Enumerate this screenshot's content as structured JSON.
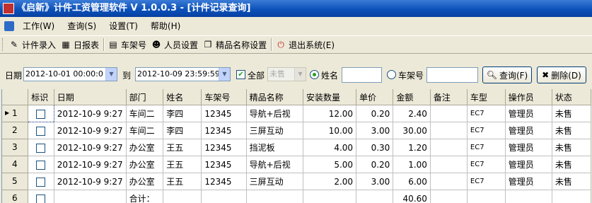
{
  "window": {
    "title": "《启新》计件工资管理软件 V 1.0.0.3 - [计件记录查询]"
  },
  "menu": [
    "工作(W)",
    "查询(S)",
    "设置(T)",
    "帮助(H)"
  ],
  "toolbar": {
    "buttons": [
      {
        "icon": "edit-icon",
        "label": "计件录入"
      },
      {
        "icon": "calendar-icon",
        "label": "日报表"
      },
      {
        "icon": "rack-icon",
        "label": "车架号"
      },
      {
        "icon": "people-icon",
        "label": "人员设置"
      },
      {
        "icon": "tag-icon",
        "label": "精品名称设置"
      },
      {
        "icon": "exit-icon",
        "label": "退出系统(E)"
      }
    ]
  },
  "filter": {
    "date_label": "日期",
    "date_from": "2012-10-01 00:00:0",
    "to_label": "到",
    "date_to": "2012-10-09 23:59:59",
    "all_label": "全部",
    "status_value": "未售",
    "name_label": "姓名",
    "rack_label": "车架号",
    "query_button": "查询(F)",
    "delete_button": "删除(D)"
  },
  "table": {
    "columns": [
      "标识",
      "日期",
      "部门",
      "姓名",
      "车架号",
      "精品名称",
      "安装数量",
      "单价",
      "金额",
      "备注",
      "车型",
      "操作员",
      "状态"
    ],
    "rows": [
      {
        "rn": "1",
        "date": "2012-10-9 9:27",
        "dept": "车间二",
        "name": "李四",
        "rack": "12345",
        "item": "导航+后视",
        "qty": "12.00",
        "price": "0.20",
        "amount": "2.40",
        "note": "",
        "model": "EC7",
        "operator": "管理员",
        "status": "未售"
      },
      {
        "rn": "2",
        "date": "2012-10-9 9:27",
        "dept": "车间二",
        "name": "李四",
        "rack": "12345",
        "item": "三屏互动",
        "qty": "10.00",
        "price": "3.00",
        "amount": "30.00",
        "note": "",
        "model": "EC7",
        "operator": "管理员",
        "status": "未售"
      },
      {
        "rn": "3",
        "date": "2012-10-9 9:27",
        "dept": "办公室",
        "name": "王五",
        "rack": "12345",
        "item": "挡泥板",
        "qty": "4.00",
        "price": "0.30",
        "amount": "1.20",
        "note": "",
        "model": "EC7",
        "operator": "管理员",
        "status": "未售"
      },
      {
        "rn": "4",
        "date": "2012-10-9 9:27",
        "dept": "办公室",
        "name": "王五",
        "rack": "12345",
        "item": "导航+后视",
        "qty": "5.00",
        "price": "0.20",
        "amount": "1.00",
        "note": "",
        "model": "EC7",
        "operator": "管理员",
        "status": "未售"
      },
      {
        "rn": "5",
        "date": "2012-10-9 9:27",
        "dept": "办公室",
        "name": "王五",
        "rack": "12345",
        "item": "三屏互动",
        "qty": "2.00",
        "price": "3.00",
        "amount": "6.00",
        "note": "",
        "model": "EC7",
        "operator": "管理员",
        "status": "未售"
      },
      {
        "rn": "6",
        "date": "",
        "dept": "合计：",
        "name": "",
        "rack": "",
        "item": "",
        "qty": "",
        "price": "",
        "amount": "40.60",
        "note": "",
        "model": "",
        "operator": "",
        "status": ""
      }
    ]
  }
}
